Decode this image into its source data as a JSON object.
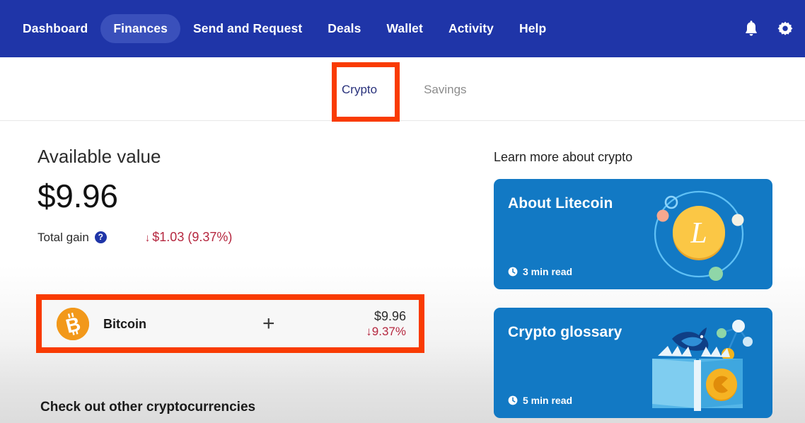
{
  "nav": {
    "items": [
      {
        "label": "Dashboard",
        "active": false
      },
      {
        "label": "Finances",
        "active": true
      },
      {
        "label": "Send and Request",
        "active": false
      },
      {
        "label": "Deals",
        "active": false
      },
      {
        "label": "Wallet",
        "active": false
      },
      {
        "label": "Activity",
        "active": false
      },
      {
        "label": "Help",
        "active": false
      }
    ],
    "icons": [
      {
        "name": "bell-icon",
        "label": "Notifications"
      },
      {
        "name": "gear-icon",
        "label": "Settings"
      }
    ],
    "background_color": "#1f35a8",
    "active_pill_color": "#3a50bb"
  },
  "tabs": [
    {
      "label": "Crypto",
      "active": true
    },
    {
      "label": "Savings",
      "active": false
    }
  ],
  "annotations": {
    "color": "#f93b02",
    "crypto_tab_highlight": true,
    "bitcoin_row_highlight": true
  },
  "summary": {
    "available_label": "Available value",
    "available_amount": "$9.96",
    "total_gain_label": "Total gain",
    "help_glyph": "?",
    "gain_arrow": "↓",
    "gain_value": "$1.03 (9.37%)",
    "gain_color": "#b5273f"
  },
  "holdings": [
    {
      "coin_symbol": "₿",
      "coin_name": "Bitcoin",
      "add_glyph": "+",
      "amount": "$9.96",
      "change_arrow": "↓",
      "change_pct": "9.37%",
      "logo_color": "#f2981a"
    }
  ],
  "other_heading": "Check out other cryptocurrencies",
  "learn": {
    "heading": "Learn more about crypto",
    "cards": [
      {
        "title": "About Litecoin",
        "read_time": "3 min read",
        "art": "litecoin-orbit",
        "bg_color": "#1279c4"
      },
      {
        "title": "Crypto glossary",
        "read_time": "5 min read",
        "art": "book-whale",
        "bg_color": "#1279c4"
      }
    ]
  }
}
